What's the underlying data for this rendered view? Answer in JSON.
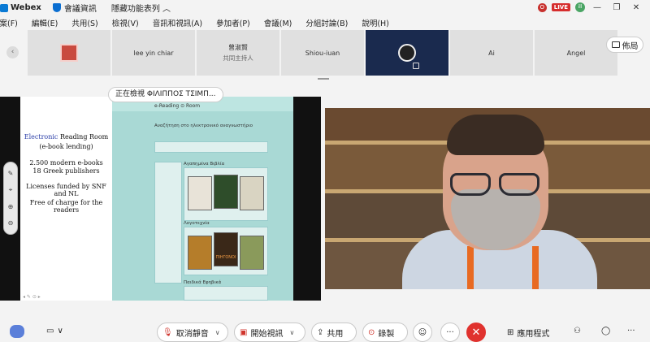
{
  "titlebar": {
    "app_name": "Webex",
    "meeting_info": "會議資訊",
    "hide_function": "隱藏功能表列 ︿",
    "live_badge": "LIVE",
    "rec_badge": "O",
    "avatar_initials": "ill",
    "minimize": "—",
    "restore": "❐",
    "close": "✕"
  },
  "menu": [
    "檔案(F)",
    "編輯(E)",
    "共用(S)",
    "檢視(V)",
    "音訊和視訊(A)",
    "參加者(P)",
    "會議(M)",
    "分組討論(B)",
    "說明(H)"
  ],
  "participants": [
    {
      "name": "",
      "role": ""
    },
    {
      "name": "lee yin chiar",
      "role": ""
    },
    {
      "name": "曾淑賢",
      "role": "共同主持人"
    },
    {
      "name": "Shiou-iuan",
      "role": ""
    },
    {
      "name": "",
      "role": ""
    },
    {
      "name": "Ai",
      "role": ""
    },
    {
      "name": "Angel",
      "role": ""
    }
  ],
  "strip": {
    "prev_arrow": "‹",
    "next_arrow": "›",
    "layout_label": "佈局"
  },
  "viewing": "正在檢視 ΦΙΛΙΠΠΟΣ ΤΣΙΜΠ...",
  "slide": {
    "line1_blue": "Electronic",
    "line1_rest": " Reading Room",
    "line2": "(e-book lending)",
    "line3": "2.500 modern e-books",
    "line4": "18 Greek publishers",
    "line5": "Licenses funded by SNF and NL",
    "line6": "Free of charge for the readers"
  },
  "shot": {
    "brand": "e-Reading ⊙ Room",
    "search_title": "Αναζήτηση στο ηλεκτρονικό αναγνωστήριο",
    "section1": "Αγαπημένα Βιβλία",
    "section2": "Λογοτεχνία",
    "section3": "Παιδικά Εφηβικά",
    "book_title": "ΠΙΗΓΟΝΟΙ"
  },
  "toolbar": {
    "mute": "取消靜音",
    "video": "開始視訊",
    "share": "共用",
    "record": "錄製",
    "more": "···",
    "end": "✕",
    "apps": "應用程式",
    "chevron": "∨"
  }
}
